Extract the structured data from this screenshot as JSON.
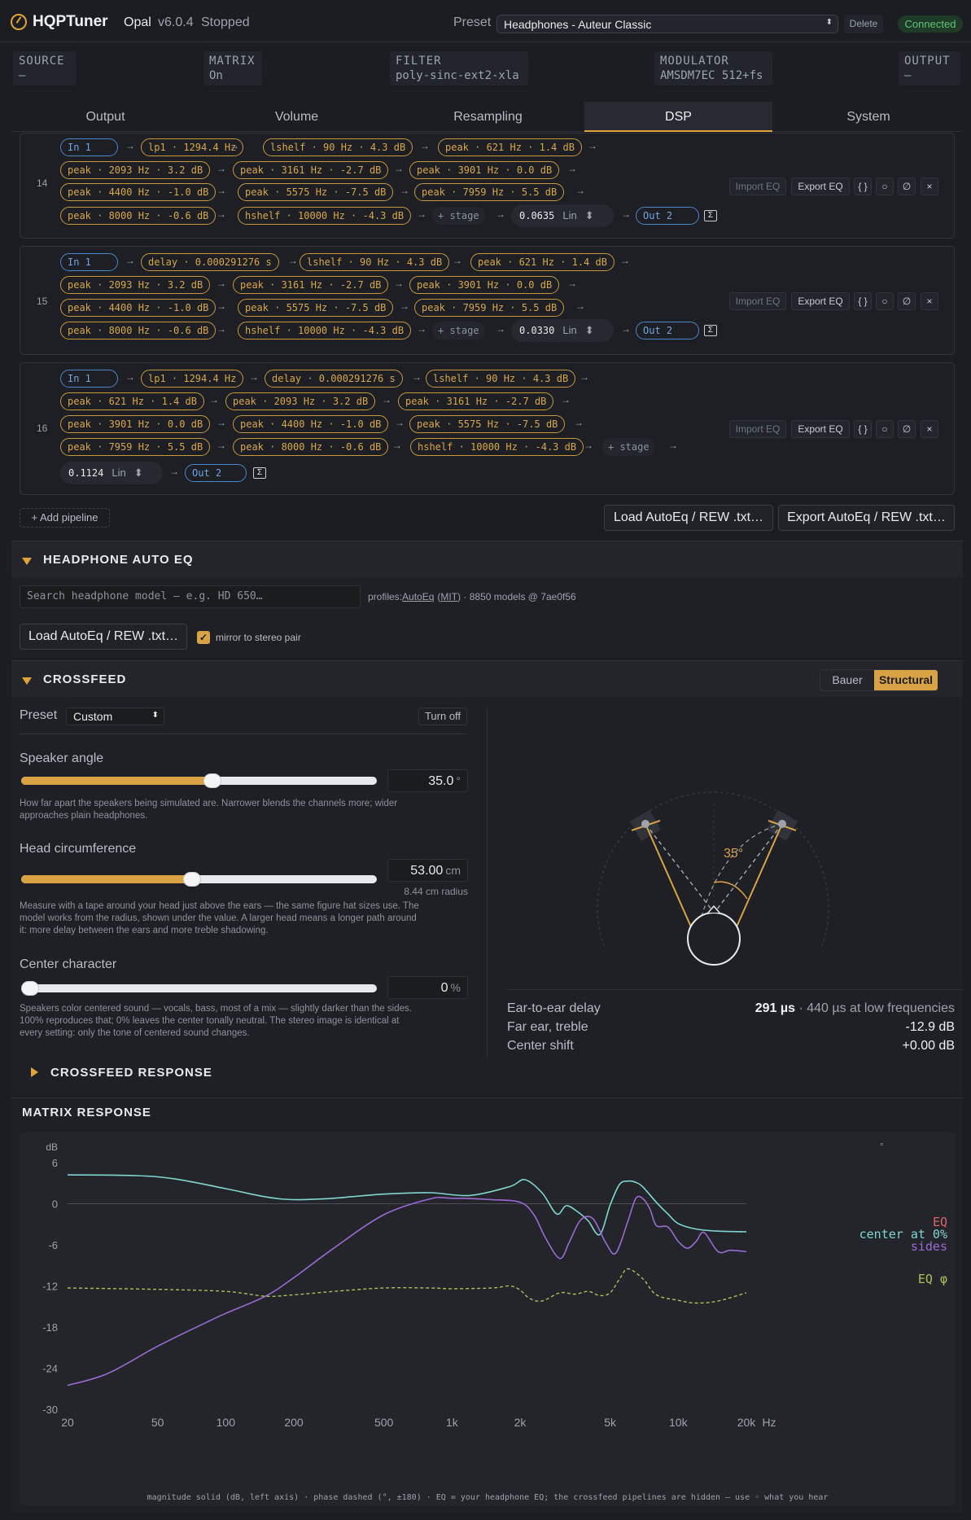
{
  "app": {
    "name": "HQPTuner",
    "edition": "Opal",
    "version": "v6.0.4",
    "state": "Stopped",
    "preset_label": "Preset",
    "preset_value": "Headphones - Auteur Classic",
    "delete_label": "Delete",
    "connection": "Connected"
  },
  "status": [
    {
      "key": "SOURCE",
      "value": "—"
    },
    {
      "key": "MATRIX",
      "value": "On"
    },
    {
      "key": "FILTER",
      "value": "poly-sinc-ext2-xla"
    },
    {
      "key": "MODULATOR",
      "value": "AMSDM7EC 512+fs"
    },
    {
      "key": "OUTPUT",
      "value": "—"
    }
  ],
  "tabs": [
    "Output",
    "Volume",
    "Resampling",
    "DSP",
    "System"
  ],
  "active_tab": "DSP",
  "pipelines": {
    "common": {
      "add_stage": "+ stage",
      "lin": "Lin",
      "import": "Import EQ",
      "export": "Export EQ",
      "braces": "{ }",
      "circle": "○",
      "nul": "∅",
      "close": "×",
      "sigma": "Σ"
    },
    "p14": {
      "num": "14",
      "in": "In 1",
      "out": "Out 2",
      "gain": "0.0635",
      "s": [
        "lp1 · 1294.4 Hz",
        "lshelf · 90 Hz · 4.3 dB",
        "peak · 621 Hz · 1.4 dB",
        "peak · 2093 Hz · 3.2 dB",
        "peak · 3161 Hz · -2.7 dB",
        "peak · 3901 Hz · 0.0 dB",
        "peak · 4400 Hz · -1.0 dB",
        "peak · 5575 Hz · -7.5 dB",
        "peak · 7959 Hz · 5.5 dB",
        "peak · 8000 Hz · -0.6 dB",
        "hshelf · 10000 Hz · -4.3 dB"
      ]
    },
    "p15": {
      "num": "15",
      "in": "In 1",
      "out": "Out 2",
      "gain": "0.0330",
      "s": [
        "delay · 0.000291276 s",
        "lshelf · 90 Hz · 4.3 dB",
        "peak · 621 Hz · 1.4 dB",
        "peak · 2093 Hz · 3.2 dB",
        "peak · 3161 Hz · -2.7 dB",
        "peak · 3901 Hz · 0.0 dB",
        "peak · 4400 Hz · -1.0 dB",
        "peak · 5575 Hz · -7.5 dB",
        "peak · 7959 Hz · 5.5 dB",
        "peak · 8000 Hz · -0.6 dB",
        "hshelf · 10000 Hz · -4.3 dB"
      ]
    },
    "p16": {
      "num": "16",
      "in": "In 1",
      "out": "Out 2",
      "gain": "0.1124",
      "s": [
        "lp1 · 1294.4 Hz",
        "delay · 0.000291276 s",
        "lshelf · 90 Hz · 4.3 dB",
        "peak · 621 Hz · 1.4 dB",
        "peak · 2093 Hz · 3.2 dB",
        "peak · 3161 Hz · -2.7 dB",
        "peak · 3901 Hz · 0.0 dB",
        "peak · 4400 Hz · -1.0 dB",
        "peak · 5575 Hz · -7.5 dB",
        "peak · 7959 Hz · 5.5 dB",
        "peak · 8000 Hz · -0.6 dB",
        "hshelf · 10000 Hz · -4.3 dB"
      ]
    },
    "add_pipeline": "+ Add pipeline",
    "load_autoeq": "Load AutoEq / REW .txt…",
    "export_autoeq": "Export AutoEq / REW .txt…"
  },
  "autoeq": {
    "title": "HEADPHONE AUTO EQ",
    "search_placeholder": "Search headphone model — e.g. HD 650…",
    "profiles_prefix": "profiles:",
    "profiles_link": "AutoEq",
    "paren_open": "(",
    "license_link": "MIT",
    "paren_close": ")",
    "profiles_suffix": " · 8850 models @ 7ae0f56",
    "load": "Load AutoEq / REW .txt…",
    "mirror": "mirror to stereo pair",
    "mirror_checked": true
  },
  "crossfeed": {
    "title": "CROSSFEED",
    "modes": [
      "Bauer",
      "Structural"
    ],
    "active_mode": "Structural",
    "preset_label": "Preset",
    "preset_value": "Custom",
    "turn_off": "Turn off",
    "speaker_angle": {
      "label": "Speaker angle",
      "value": "35.0",
      "unit": "°",
      "fraction": 0.54,
      "help": "How far apart the speakers being simulated are. Narrower blends the channels more; wider approaches plain headphones."
    },
    "head": {
      "label": "Head circumference",
      "value": "53.00",
      "unit": "cm",
      "fraction": 0.48,
      "sub": "8.44 cm radius",
      "help": "Measure with a tape around your head just above the ears — the same figure hat sizes use. The model works from the radius, shown under the value. A larger head means a longer path around it: more delay between the ears and more treble shadowing."
    },
    "center": {
      "label": "Center character",
      "value": "0",
      "unit": "%",
      "fraction": 0.0,
      "help": "Speakers color centered sound — vocals, bass, most of a mix — slightly darker than the sides. 100% reproduces that; 0% leaves the center tonally neutral. The stereo image is identical at every setting: only the tone of centered sound changes."
    },
    "angle_label": "35°",
    "stats": [
      {
        "label": "Ear-to-ear delay",
        "value": "291 µs",
        "extra": " · 440 µs at low frequencies"
      },
      {
        "label": "Far ear, treble",
        "value": "-12.9 dB",
        "extra": ""
      },
      {
        "label": "Center shift",
        "value": "+0.00 dB",
        "extra": ""
      }
    ],
    "response_title": "CROSSFEED RESPONSE"
  },
  "matrix": {
    "title": "MATRIX RESPONSE",
    "footer": "magnitude solid (dB, left axis) · phase dashed (°, ±180) · EQ = your headphone EQ; the crossfeed pipelines are hidden — use ◦ what you hear",
    "right_unit": "°"
  },
  "chart_data": {
    "type": "line",
    "xlabel": "Hz",
    "ylabel": "dB",
    "x_scale": "log",
    "xlim": [
      20,
      20000
    ],
    "ylim": [
      -30,
      6
    ],
    "x_ticks": [
      "20",
      "50",
      "100",
      "200",
      "500",
      "1k",
      "2k",
      "5k",
      "10k",
      "20k"
    ],
    "x_tick_values": [
      20,
      50,
      100,
      200,
      500,
      1000,
      2000,
      5000,
      10000,
      20000
    ],
    "y_ticks": [
      6,
      0,
      -6,
      -12,
      -18,
      -24,
      -30
    ],
    "legend_position": "right",
    "series": [
      {
        "name": "EQ",
        "color": "#e06464",
        "style": "solid",
        "x": [],
        "y": []
      },
      {
        "name": "center at 0%",
        "color": "#7fd6cf",
        "style": "solid",
        "x": [
          20,
          40,
          60,
          100,
          150,
          200,
          300,
          500,
          800,
          1200,
          1800,
          2100,
          2500,
          2900,
          3200,
          3600,
          4000,
          4500,
          5000,
          5500,
          6000,
          6500,
          7000,
          8000,
          9000,
          10000,
          12000,
          15000,
          20000
        ],
        "y": [
          4.2,
          4.1,
          3.6,
          2.2,
          1.0,
          0.6,
          0.8,
          1.4,
          1.6,
          1.2,
          2.5,
          3.5,
          1.6,
          -1.5,
          -0.3,
          -1.2,
          -2.5,
          -4.5,
          -0.2,
          2.8,
          3.3,
          3.1,
          2.4,
          0.2,
          -1.5,
          -2.9,
          -3.7,
          -4.0,
          -4.1
        ]
      },
      {
        "name": "sides",
        "color": "#9b6ad4",
        "style": "solid",
        "x": [
          20,
          30,
          50,
          80,
          100,
          150,
          200,
          300,
          500,
          800,
          1000,
          1500,
          2000,
          2300,
          2600,
          3000,
          3300,
          3700,
          4200,
          4800,
          5300,
          6000,
          6500,
          7000,
          7500,
          8000,
          9000,
          10000,
          11000,
          12000,
          13000,
          15000,
          17000,
          20000
        ],
        "y": [
          -26.5,
          -24.8,
          -20.8,
          -17.5,
          -16.0,
          -13.5,
          -10.8,
          -6.5,
          -1.6,
          0.7,
          0.8,
          0.6,
          0.2,
          -1.6,
          -5.1,
          -8.0,
          -5.6,
          -2.4,
          -2.2,
          -5.8,
          -7.2,
          -2.5,
          0.8,
          0.7,
          -0.8,
          -3.2,
          -3.4,
          -5.5,
          -6.5,
          -5.5,
          -4.2,
          -7.0,
          -6.8,
          -7.0
        ]
      },
      {
        "name": "EQ φ",
        "color": "#a6c158",
        "style": "dashed",
        "x": [
          20,
          50,
          100,
          150,
          200,
          300,
          500,
          800,
          1000,
          1500,
          1800,
          2000,
          2200,
          2500,
          3000,
          3500,
          4000,
          4500,
          5000,
          5500,
          6000,
          7000,
          8000,
          10000,
          12000,
          15000,
          20000
        ],
        "y": [
          -12.3,
          -12.5,
          -12.8,
          -13.5,
          -13.3,
          -12.8,
          -12.3,
          -12.3,
          -12.4,
          -12.3,
          -12.0,
          -12.6,
          -13.8,
          -14.2,
          -13.0,
          -13.2,
          -12.8,
          -13.4,
          -13.0,
          -11.0,
          -9.5,
          -11.0,
          -13.3,
          -14.1,
          -14.5,
          -14.2,
          -13.0
        ]
      }
    ]
  }
}
